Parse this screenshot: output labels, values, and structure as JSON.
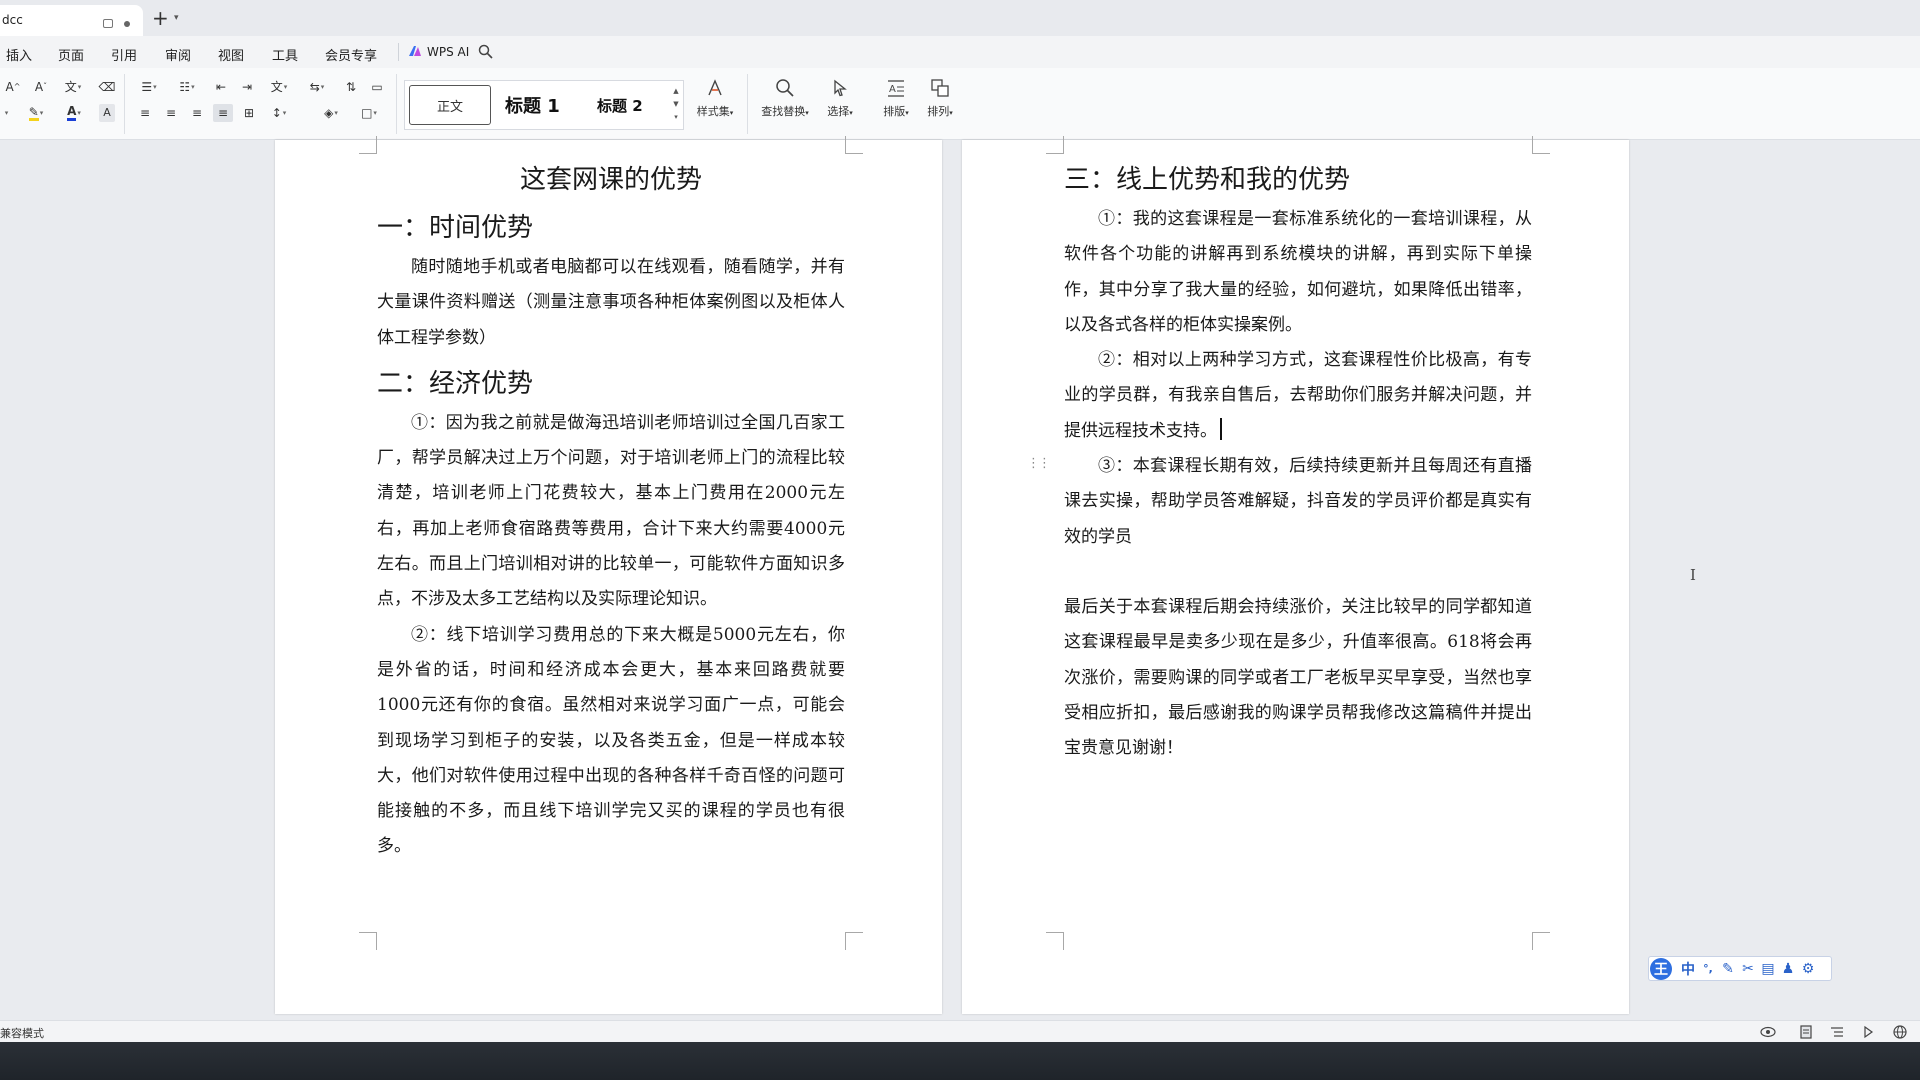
{
  "window": {
    "tab_title": "dcc",
    "new_tab_symbol": "+"
  },
  "menu": {
    "items": [
      "插入",
      "页面",
      "引用",
      "审阅",
      "视图",
      "工具",
      "会员专享"
    ],
    "wps_ai_label": "WPS AI"
  },
  "ribbon": {
    "styles": {
      "normal": "正文",
      "heading1": "标题 1",
      "heading2": "标题 2"
    },
    "style_set_label": "样式集",
    "find_replace_label": "查找替换",
    "select_label": "选择",
    "layout_label": "排版",
    "arrange_label": "排列"
  },
  "doc": {
    "left": {
      "title": "这套网课的优势",
      "h1": "一：时间优势",
      "p1": "随时随地手机或者电脑都可以在线观看，随看随学，并有大量课件资料赠送（测量注意事项各种柜体案例图以及柜体人体工程学参数）",
      "h2": "二：经济优势",
      "p2": "①：因为我之前就是做海迅培训老师培训过全国几百家工厂，帮学员解决过上万个问题，对于培训老师上门的流程比较清楚，培训老师上门花费较大，基本上门费用在2000元左右，再加上老师食宿路费等费用，合计下来大约需要4000元左右。而且上门培训相对讲的比较单一，可能软件方面知识多点，不涉及太多工艺结构以及实际理论知识。",
      "p3": "②：线下培训学习费用总的下来大概是5000元左右，你是外省的话，时间和经济成本会更大，基本来回路费就要1000元还有你的食宿。虽然相对来说学习面广一点，可能会到现场学习到柜子的安装，以及各类五金，但是一样成本较大，他们对软件使用过程中出现的各种各样千奇百怪的问题可能接触的不多，而且线下培训学完又买的课程的学员也有很多。"
    },
    "right": {
      "h3": "三：线上优势和我的优势",
      "p1": "①：我的这套课程是一套标准系统化的一套培训课程，从软件各个功能的讲解再到系统模块的讲解，再到实际下单操作，其中分享了我大量的经验，如何避坑，如果降低出错率，以及各式各样的柜体实操案例。",
      "p2": "②：相对以上两种学习方式，这套课程性价比极高，有专业的学员群，有我亲自售后，去帮助你们服务并解决问题，并提供远程技术支持。",
      "p3": "③：本套课程长期有效，后续持续更新并且每周还有直播课去实操，帮助学员答难解疑，抖音发的学员评价都是真实有效的学员",
      "p4": "最后关于本套课程后期会持续涨价，关注比较早的同学都知道这套课程最早是卖多少现在是多少，升值率很高。618将会再次涨价，需要购课的同学或者工厂老板早买早享受，当然也享受相应折扣，最后感谢我的购课学员帮我修改这篇稿件并提出宝贵意见谢谢！"
    }
  },
  "ime": {
    "logo": "王",
    "mode": "中",
    "punct": "°,"
  },
  "status": {
    "mode_text": "兼容模式"
  }
}
